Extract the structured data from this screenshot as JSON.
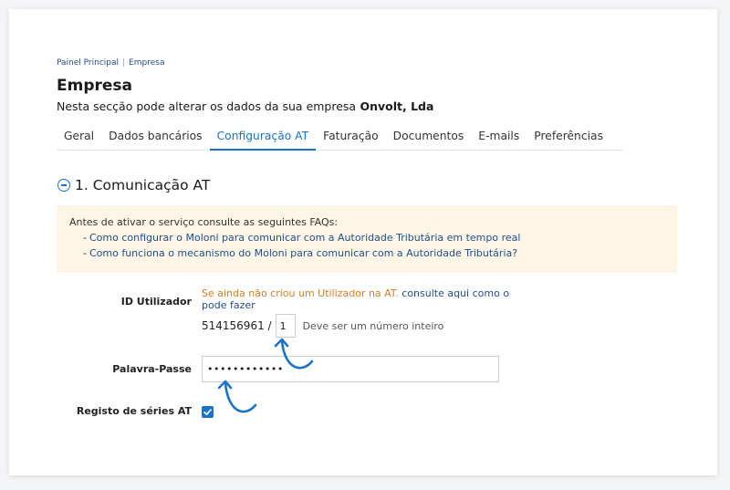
{
  "breadcrumb": {
    "home": "Painel Principal",
    "separator": "|",
    "current": "Empresa"
  },
  "page": {
    "title": "Empresa",
    "subtitle_text": "Nesta secção pode alterar os dados da sua empresa",
    "company_name": "Onvolt, Lda"
  },
  "tabs": [
    {
      "label": "Geral"
    },
    {
      "label": "Dados bancários"
    },
    {
      "label": "Configuração AT",
      "active": true
    },
    {
      "label": "Faturação"
    },
    {
      "label": "Documentos"
    },
    {
      "label": "E-mails"
    },
    {
      "label": "Preferências"
    }
  ],
  "section": {
    "title": "1. Comunicação AT",
    "icon": "minus-circle-icon"
  },
  "faq": {
    "intro": "Antes de ativar o serviço consulte as seguintes FAQs:",
    "dash": "-",
    "links": [
      "Como configurar o Moloni para comunicar com a Autoridade Tributária em tempo real",
      "Como funciona o mecanismo do Moloni para comunicar com a Autoridade Tributária?"
    ]
  },
  "form": {
    "user_id": {
      "label": "ID Utilizador",
      "warning_text": "Se ainda não criou um Utilizador na AT.",
      "warning_link": "consulte aqui como o pode fazer",
      "nif_prefix": "514156961 /",
      "value": "1",
      "hint": "Deve ser um número inteiro"
    },
    "password": {
      "label": "Palavra-Passe",
      "value": "••••••••••••"
    },
    "series_registration": {
      "label": "Registo de séries AT",
      "checked": true
    }
  },
  "colors": {
    "accent": "#1a73c9",
    "warning": "#e07b23",
    "faq_background": "#fdf6e6",
    "link": "#1f4e8c"
  }
}
